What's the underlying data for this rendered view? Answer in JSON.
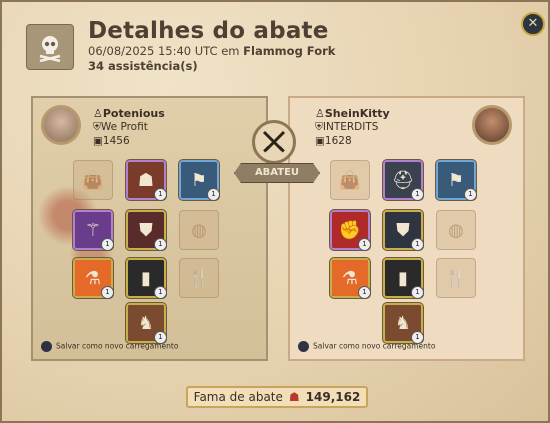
{
  "header": {
    "title": "Detalhes do abate",
    "datetime": "06/08/2025 15:40 UTC",
    "location_prefix": "em",
    "location": "Flammog Fork",
    "assists": "34 assistência(s)"
  },
  "center": {
    "verb": "ABATEU"
  },
  "killer": {
    "name": "Potenious",
    "guild": "We Profit",
    "ip": "1456",
    "save_label": "Salvar como novo carregamento",
    "equipment": [
      {
        "slot": "bag",
        "state": "empty",
        "icon": "bag-icon"
      },
      {
        "slot": "head",
        "state": "item",
        "icon": "hood-icon",
        "tier": "1"
      },
      {
        "slot": "cape",
        "state": "item",
        "icon": "cape-icon",
        "tier": "1"
      },
      {
        "slot": "mainhand",
        "state": "item",
        "icon": "staff-icon",
        "tier": "1"
      },
      {
        "slot": "chest",
        "state": "item",
        "icon": "robe-icon",
        "tier": "1"
      },
      {
        "slot": "offhand",
        "state": "empty",
        "icon": "offhand-icon"
      },
      {
        "slot": "potion",
        "state": "item",
        "icon": "potion-icon",
        "tier": "1"
      },
      {
        "slot": "shoes",
        "state": "item",
        "icon": "boots-icon",
        "tier": "1"
      },
      {
        "slot": "food",
        "state": "empty",
        "icon": "food-icon"
      },
      {
        "slot": "mount",
        "state": "item",
        "icon": "mount-icon",
        "tier": "1"
      }
    ]
  },
  "victim": {
    "name": "SheinKitty",
    "guild": "INTERDITS",
    "ip": "1628",
    "save_label": "Salvar como novo carregamento",
    "equipment": [
      {
        "slot": "bag",
        "state": "empty",
        "icon": "bag-icon"
      },
      {
        "slot": "head",
        "state": "item",
        "icon": "helmet-icon",
        "tier": "1"
      },
      {
        "slot": "cape",
        "state": "item",
        "icon": "cape-icon",
        "tier": "1"
      },
      {
        "slot": "mainhand",
        "state": "item",
        "icon": "gauntlet-icon",
        "tier": "1"
      },
      {
        "slot": "chest",
        "state": "item",
        "icon": "armor-icon",
        "tier": "1"
      },
      {
        "slot": "offhand",
        "state": "empty",
        "icon": "offhand-icon"
      },
      {
        "slot": "potion",
        "state": "item",
        "icon": "potion-icon",
        "tier": "1"
      },
      {
        "slot": "shoes",
        "state": "item",
        "icon": "boots-icon",
        "tier": "1"
      },
      {
        "slot": "food",
        "state": "empty",
        "icon": "food-icon"
      },
      {
        "slot": "mount",
        "state": "item",
        "icon": "mount-icon",
        "tier": "1"
      }
    ]
  },
  "fame": {
    "label": "Fama de abate",
    "value": "149,162"
  },
  "colors": {
    "parchment": "#e9d8b9",
    "gold_border": "#c9a559",
    "text": "#3b2f25"
  }
}
